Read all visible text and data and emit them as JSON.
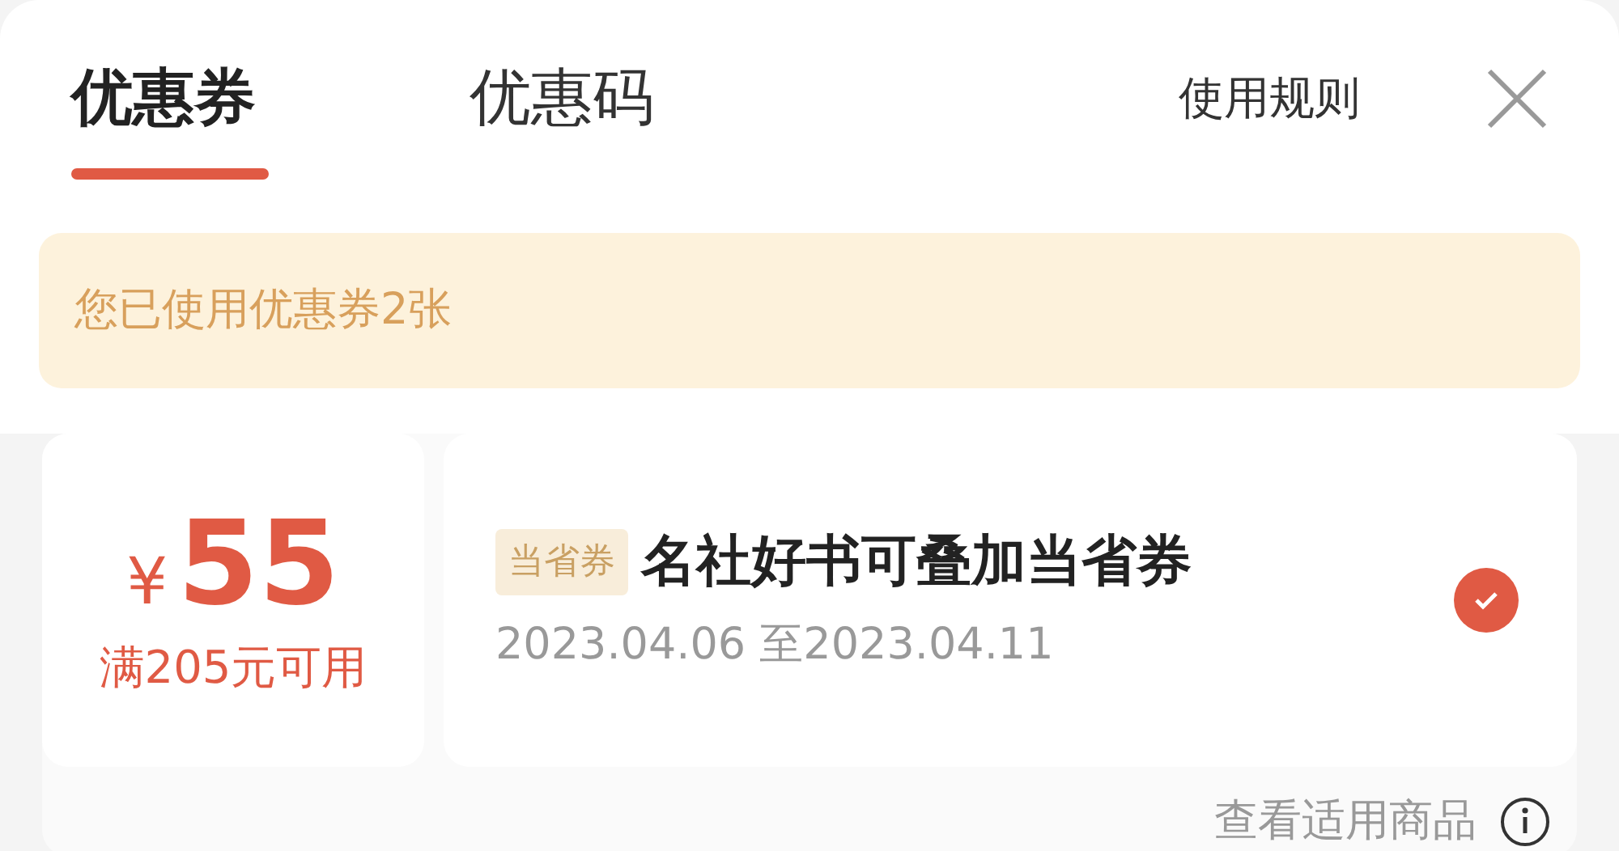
{
  "tabs": [
    {
      "label": "优惠券",
      "selected": true
    },
    {
      "label": "优惠码",
      "selected": false
    }
  ],
  "rules_link": "使用规则",
  "notice": "您已使用优惠券2张",
  "coupons": [
    {
      "currency": "¥",
      "amount": "55",
      "condition": "满205元可用",
      "tag": "当省券",
      "title": "名社好书可叠加当省券",
      "validity": "2023.04.06 至2023.04.11",
      "checked": true,
      "footer_link": "查看适用商品"
    }
  ]
}
